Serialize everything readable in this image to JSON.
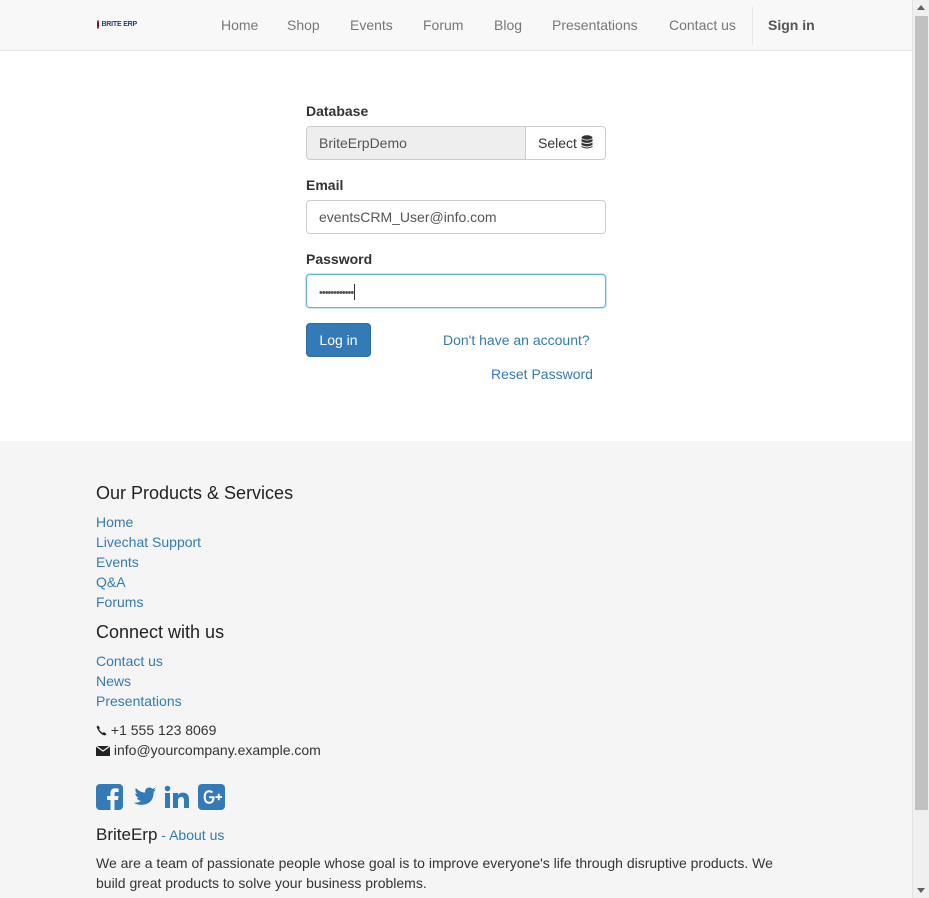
{
  "navbar": {
    "logo_text": "BRITE ERP",
    "items": [
      {
        "label": "Home"
      },
      {
        "label": "Shop"
      },
      {
        "label": "Events"
      },
      {
        "label": "Forum"
      },
      {
        "label": "Blog"
      },
      {
        "label": "Presentations"
      },
      {
        "label": "Contact us"
      }
    ],
    "sign_in": "Sign in"
  },
  "login": {
    "database_label": "Database",
    "database_value": "BriteErpDemo",
    "select_label": "Select",
    "email_label": "Email",
    "email_value": "eventsCRM_User@info.com",
    "password_label": "Password",
    "password_value": "••••••••••••",
    "login_button": "Log in",
    "signup_link": "Don't have an account?",
    "reset_link": "Reset Password"
  },
  "footer": {
    "products_heading": "Our Products & Services",
    "products_links": [
      "Home",
      "Livechat Support",
      "Events",
      "Q&A",
      "Forums"
    ],
    "connect_heading": "Connect with us",
    "connect_links": [
      "Contact us",
      "News",
      "Presentations"
    ],
    "phone": "+1 555 123 8069",
    "email": "info@yourcompany.example.com",
    "social_icons": [
      "facebook-icon",
      "twitter-icon",
      "linkedin-icon",
      "google-plus-icon"
    ],
    "company_name": "BriteErp",
    "about_separator": " - ",
    "about_link": "About us",
    "description_line1": "We are a team of passionate people whose goal is to improve everyone's life through disruptive products. We",
    "description_line2": "build great products to solve your business problems."
  },
  "colors": {
    "link": "#337ab7",
    "primary_button": "#337ab7",
    "navbar_bg": "#f8f8f8",
    "footer_bg": "#f5f5f5"
  }
}
